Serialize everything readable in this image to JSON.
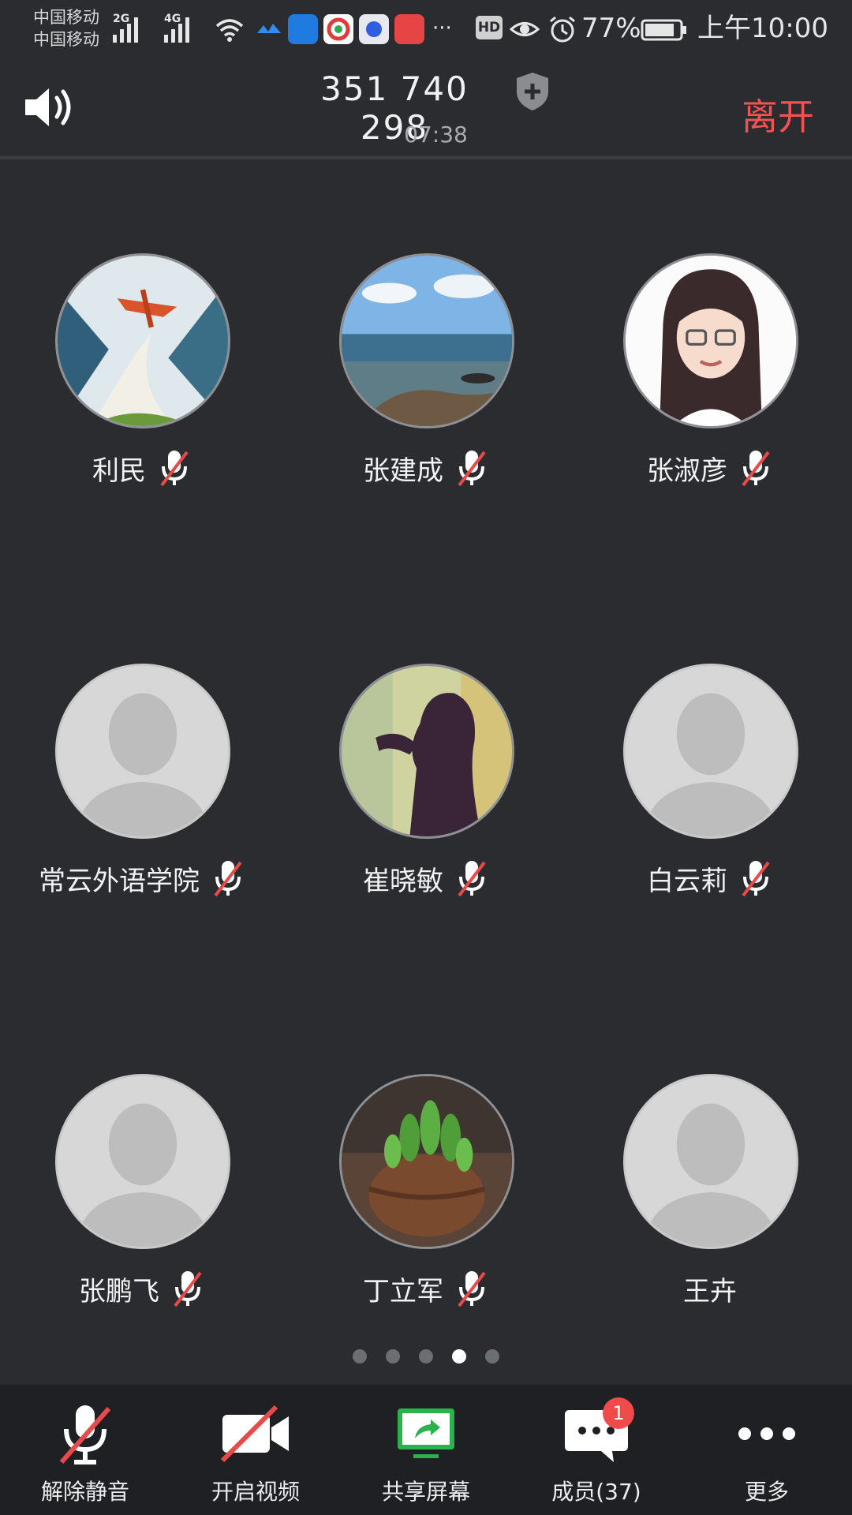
{
  "status_bar": {
    "carrier_1": "中国移动",
    "carrier_2": "中国移动",
    "net_1": "2G",
    "net_2": "4G",
    "more": "···",
    "hd": "HD",
    "battery": "77%",
    "time": "上午10:00"
  },
  "header": {
    "meeting_id": "351 740 298",
    "timer": "07:38",
    "leave_label": "离开"
  },
  "participants": [
    {
      "name": "利民",
      "muted": true,
      "avatar": "plane-painting"
    },
    {
      "name": "张建成",
      "muted": true,
      "avatar": "seaside-photo"
    },
    {
      "name": "张淑彦",
      "muted": true,
      "avatar": "cartoon-girl"
    },
    {
      "name": "常云外语学院",
      "muted": true,
      "avatar": "default"
    },
    {
      "name": "崔晓敏",
      "muted": true,
      "avatar": "silhouette-art"
    },
    {
      "name": "白云莉",
      "muted": true,
      "avatar": "default"
    },
    {
      "name": "张鹏飞",
      "muted": true,
      "avatar": "default"
    },
    {
      "name": "丁立军",
      "muted": true,
      "avatar": "pea-pot"
    },
    {
      "name": "王卉",
      "muted": false,
      "avatar": "default"
    }
  ],
  "pagination": {
    "pages": 5,
    "current": 4
  },
  "toolbar": {
    "unmute_label": "解除静音",
    "video_label": "开启视频",
    "share_label": "共享屏幕",
    "members_label": "成员(37)",
    "members_badge": "1",
    "more_label": "更多"
  },
  "colors": {
    "background": "#2a2c30",
    "toolbar": "#1e2023",
    "leave": "#f25252",
    "mute_slash": "#e84a4a",
    "share_green": "#2bb24c",
    "badge": "#f04b4b"
  }
}
